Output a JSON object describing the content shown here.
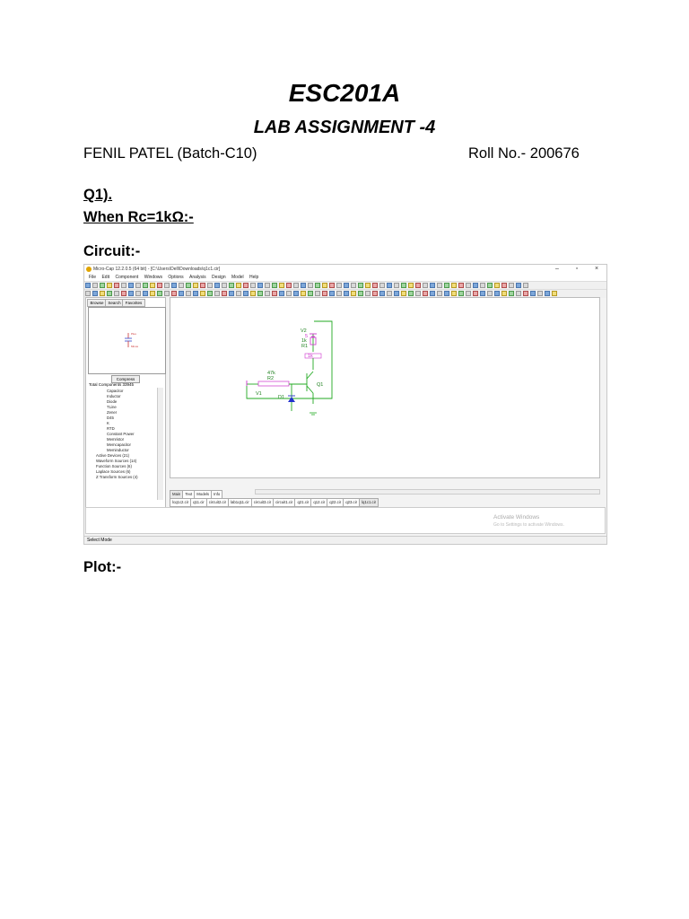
{
  "doc": {
    "title": "ESC201A",
    "subtitle": "LAB ASSIGNMENT -4",
    "author": "FENIL PATEL  (Batch-C10)",
    "roll": "Roll No.- 200676",
    "q1": "Q1).",
    "condition": "When Rc=1kΩ:-",
    "circuit_label": "Circuit:-",
    "plot_label": "Plot:-"
  },
  "screenshot": {
    "window_title": "Micro-Cap 12.2.0.5 (64 bit) - [C:\\Users\\Dell\\Downloads\\q1c1.cir]",
    "menu": [
      "File",
      "Edit",
      "Component",
      "Windows",
      "Options",
      "Analysis",
      "Design",
      "Model",
      "Help"
    ],
    "panel_tabs": [
      "Browse",
      "Search",
      "Favorites"
    ],
    "compress_label": "Compress",
    "total_components": "Total Components 33945",
    "tree_items": [
      "Capacitor",
      "Inductor",
      "Diode",
      "TLine",
      "Zener",
      "D45",
      "K",
      "RTD",
      "Constant Power",
      "Memristor",
      "Memcapacitor",
      "Meminductor",
      "Active Devices (21)",
      "Waveform Sources (14)",
      "Function Sources (6)",
      "Laplace Sources (6)",
      "Z Transform Sources (4)"
    ],
    "sheet_tabs": [
      "Main",
      "Text",
      "Models",
      "Info"
    ],
    "file_tabs": [
      "lcq1c2.cir",
      "q11.cir",
      "circuit2.cir",
      "lab1q11.cir",
      "circuit3.cir",
      "circuit1.cir",
      "q21.cir",
      "q12.cir",
      "q22.cir",
      "q23.cir",
      "lq1c1.cir"
    ],
    "activate_title": "Activate Windows",
    "activate_sub": "Go to Settings to activate Windows.",
    "status": "Select Mode",
    "circuit": {
      "v2_label": "V2",
      "v2_value": "5",
      "r1_label": "R1",
      "r1_value": "1k",
      "r1_extra": "1k",
      "r2_label": "R2",
      "r2_value": "47k",
      "q1_label": "Q1",
      "d1_label": "D1",
      "v1_label": "V1"
    },
    "colors": {
      "wire": "#22aa22",
      "component": "#cc33cc",
      "label_text": "#1a7f1a",
      "diode": "#2233cc"
    }
  }
}
